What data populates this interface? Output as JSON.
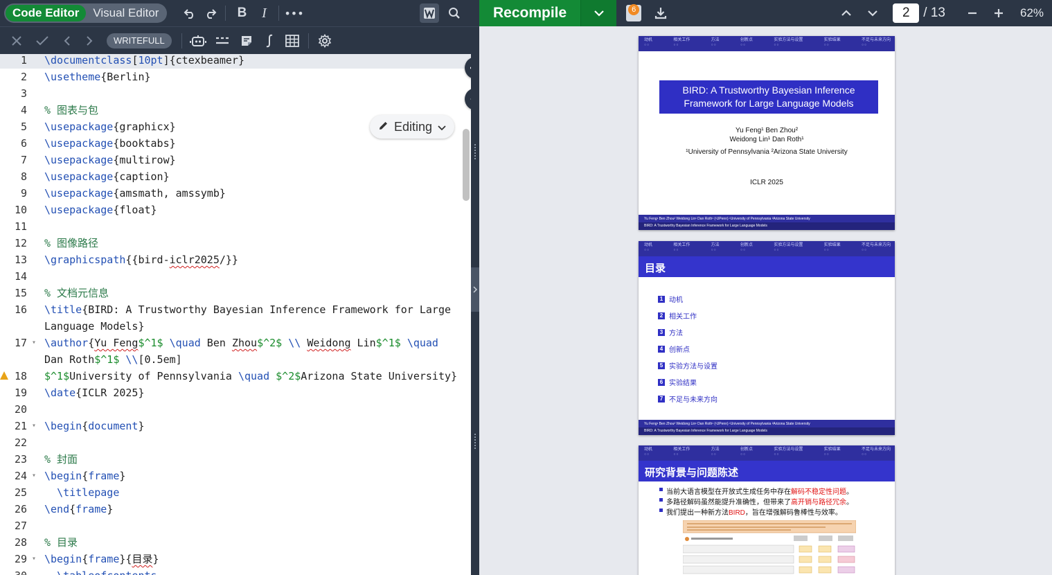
{
  "toolbar": {
    "mode_code": "Code Editor",
    "mode_visual": "Visual Editor",
    "writefull": "WRITEFULL"
  },
  "pdf_toolbar": {
    "recompile": "Recompile",
    "log_badge": "6",
    "page_current": "2",
    "page_total": "/ 13",
    "zoom": "62%"
  },
  "editor": {
    "editing_label": "Editing",
    "lines": [
      {
        "n": "1",
        "parts": [
          [
            "kw",
            "\\documentclass"
          ],
          [
            "t",
            "["
          ],
          [
            "kw",
            "10pt"
          ],
          [
            "t",
            "]{ctexbeamer}"
          ]
        ]
      },
      {
        "n": "2",
        "parts": [
          [
            "kw",
            "\\usetheme"
          ],
          [
            "t",
            "{Berlin}"
          ]
        ]
      },
      {
        "n": "3",
        "parts": []
      },
      {
        "n": "4",
        "parts": [
          [
            "cm",
            "% 图表与包"
          ]
        ]
      },
      {
        "n": "5",
        "parts": [
          [
            "kw",
            "\\usepackage"
          ],
          [
            "t",
            "{graphicx}"
          ]
        ]
      },
      {
        "n": "6",
        "parts": [
          [
            "kw",
            "\\usepackage"
          ],
          [
            "t",
            "{booktabs}"
          ]
        ]
      },
      {
        "n": "7",
        "parts": [
          [
            "kw",
            "\\usepackage"
          ],
          [
            "t",
            "{multirow}"
          ]
        ]
      },
      {
        "n": "8",
        "parts": [
          [
            "kw",
            "\\usepackage"
          ],
          [
            "t",
            "{caption}"
          ]
        ]
      },
      {
        "n": "9",
        "parts": [
          [
            "kw",
            "\\usepackage"
          ],
          [
            "t",
            "{amsmath, amssymb}"
          ]
        ]
      },
      {
        "n": "10",
        "parts": [
          [
            "kw",
            "\\usepackage"
          ],
          [
            "t",
            "{float}"
          ]
        ]
      },
      {
        "n": "11",
        "parts": []
      },
      {
        "n": "12",
        "parts": [
          [
            "cm",
            "% 图像路径"
          ]
        ]
      },
      {
        "n": "13",
        "parts": [
          [
            "kw",
            "\\graphicspath"
          ],
          [
            "t",
            "{{bird-"
          ],
          [
            "sq",
            "iclr2025"
          ],
          [
            "t",
            "/}}"
          ]
        ]
      },
      {
        "n": "14",
        "parts": []
      },
      {
        "n": "15",
        "parts": [
          [
            "cm",
            "% 文档元信息"
          ]
        ]
      },
      {
        "n": "16",
        "parts": [
          [
            "kw",
            "\\title"
          ],
          [
            "t",
            "{BIRD: A Trustworthy Bayesian Inference Framework for Large"
          ]
        ]
      },
      {
        "n": "",
        "parts": [
          [
            "t",
            "Language Models}"
          ]
        ]
      },
      {
        "n": "17",
        "parts": [
          [
            "kw",
            "\\author"
          ],
          [
            "t",
            "{"
          ],
          [
            "sq",
            "Yu Feng"
          ],
          [
            "mt",
            "$^1$"
          ],
          [
            "t",
            " "
          ],
          [
            "kw",
            "\\quad"
          ],
          [
            "t",
            " Ben "
          ],
          [
            "sq",
            "Zhou"
          ],
          [
            "mt",
            "$^2$"
          ],
          [
            "t",
            " "
          ],
          [
            "kw",
            "\\\\"
          ],
          [
            "t",
            " "
          ],
          [
            "sq",
            "Weidong"
          ],
          [
            "t",
            " Lin"
          ],
          [
            "mt",
            "$^1$"
          ],
          [
            "t",
            " "
          ],
          [
            "kw",
            "\\quad"
          ]
        ]
      },
      {
        "n": "",
        "parts": [
          [
            "t",
            "Dan Roth"
          ],
          [
            "mt",
            "$^1$"
          ],
          [
            "t",
            " "
          ],
          [
            "kw",
            "\\\\"
          ],
          [
            "t",
            "[0.5em]"
          ]
        ]
      },
      {
        "n": "18",
        "parts": [
          [
            "mt",
            "$^1$"
          ],
          [
            "t",
            "University of Pennsylvania "
          ],
          [
            "kw",
            "\\quad"
          ],
          [
            "t",
            " "
          ],
          [
            "mt",
            "$^2$"
          ],
          [
            "t",
            "Arizona State University}"
          ]
        ]
      },
      {
        "n": "19",
        "parts": [
          [
            "kw",
            "\\date"
          ],
          [
            "t",
            "{ICLR 2025}"
          ]
        ]
      },
      {
        "n": "20",
        "parts": []
      },
      {
        "n": "21",
        "parts": [
          [
            "kw",
            "\\begin"
          ],
          [
            "t",
            "{"
          ],
          [
            "kw",
            "document"
          ],
          [
            "t",
            "}"
          ]
        ]
      },
      {
        "n": "22",
        "parts": []
      },
      {
        "n": "23",
        "parts": [
          [
            "cm",
            "% 封面"
          ]
        ]
      },
      {
        "n": "24",
        "parts": [
          [
            "kw",
            "\\begin"
          ],
          [
            "t",
            "{"
          ],
          [
            "kw",
            "frame"
          ],
          [
            "t",
            "}"
          ]
        ]
      },
      {
        "n": "25",
        "parts": [
          [
            "t",
            "  "
          ],
          [
            "kw",
            "\\titlepage"
          ]
        ]
      },
      {
        "n": "26",
        "parts": [
          [
            "kw",
            "\\end"
          ],
          [
            "t",
            "{"
          ],
          [
            "kw",
            "frame"
          ],
          [
            "t",
            "}"
          ]
        ]
      },
      {
        "n": "27",
        "parts": []
      },
      {
        "n": "28",
        "parts": [
          [
            "cm",
            "% 目录"
          ]
        ]
      },
      {
        "n": "29",
        "parts": [
          [
            "kw",
            "\\begin"
          ],
          [
            "t",
            "{"
          ],
          [
            "kw",
            "frame"
          ],
          [
            "t",
            "}{"
          ],
          [
            "sq",
            "目录"
          ],
          [
            "t",
            "}"
          ]
        ]
      },
      {
        "n": "30",
        "parts": [
          [
            "t",
            "  "
          ],
          [
            "kw",
            "\\tableofcontents"
          ]
        ]
      }
    ]
  },
  "pdf": {
    "nav_sections": [
      "动机",
      "相关工作",
      "方法",
      "创新点",
      "实验方法与设置",
      "实验结果",
      "不足与未来方向"
    ],
    "footer_line1": "Yu Feng¹     Ben Zhou²     Weidong Lin¹     Dan Roth¹   (¹UPenn)   ¹University of Pennsylvania   ²Arizona State University",
    "footer_line2": "BIRD: A Trustworthy Bayesian Inference Framework for Large Language Models",
    "slide1": {
      "title_l1": "BIRD: A Trustworthy Bayesian Inference",
      "title_l2": "Framework for Large Language Models",
      "authors_l1": "Yu Feng¹     Ben Zhou²",
      "authors_l2": "Weidong Lin¹     Dan Roth¹",
      "affil": "¹University of Pennsylvania    ²Arizona State University",
      "date": "ICLR 2025"
    },
    "slide2": {
      "title": "目录",
      "items": [
        "动机",
        "相关工作",
        "方法",
        "创新点",
        "实验方法与设置",
        "实验结果",
        "不足与未来方向"
      ]
    },
    "slide3": {
      "title": "研究背景与问题陈述",
      "b1_a": "当前大语言模型在开放式生成任务中存在",
      "b1_b": "解码不稳定性问题",
      "b1_c": "。",
      "b2_a": "多路径解码虽然能提升准确性，但带来了",
      "b2_b": "高开销与路径冗余",
      "b2_c": "。",
      "b3_a": "我们提出一种新方法",
      "b3_b": "BIRD",
      "b3_c": "，旨在增强解码鲁棒性与效率。"
    }
  }
}
